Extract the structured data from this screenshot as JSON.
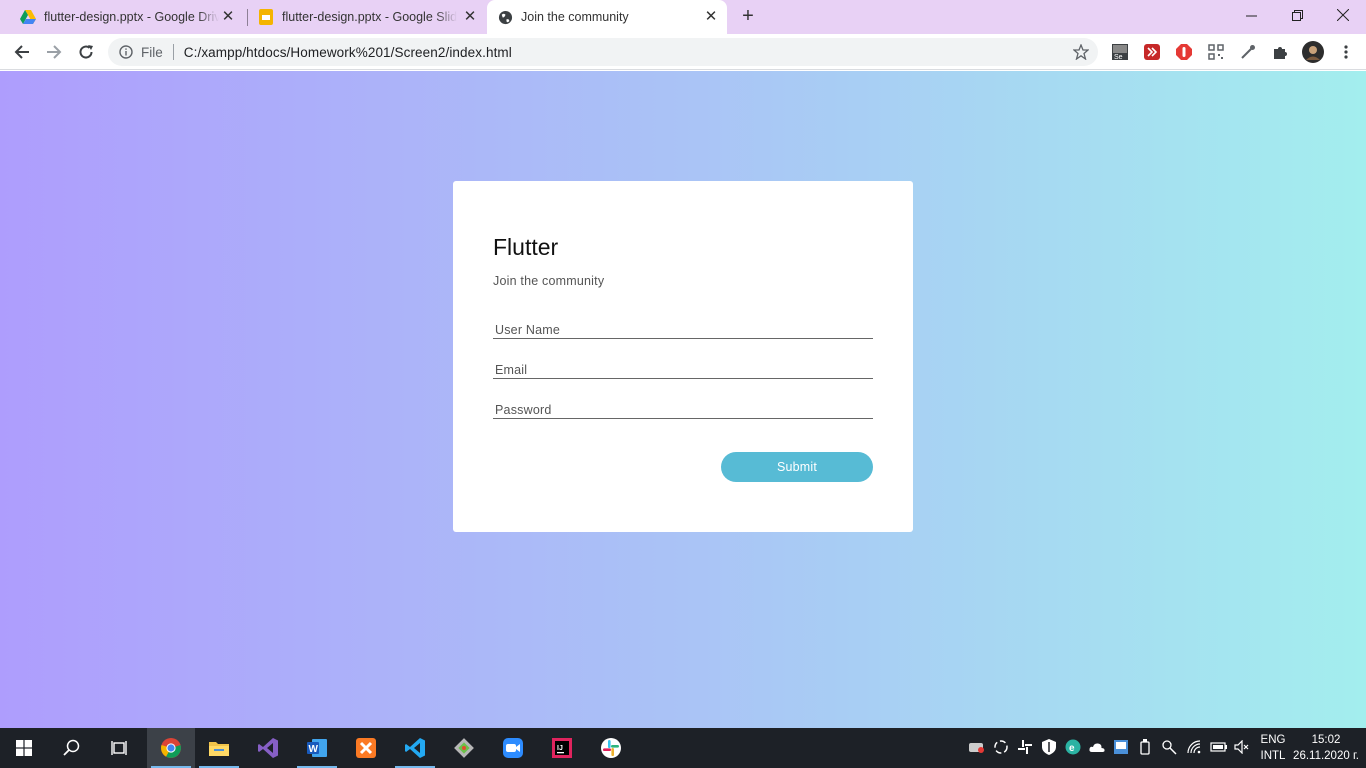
{
  "browser": {
    "tabs": [
      {
        "title": "flutter-design.pptx - Google Drive",
        "icon": "google-drive-icon",
        "active": false
      },
      {
        "title": "flutter-design.pptx - Google Slides",
        "icon": "google-slides-icon",
        "active": false
      },
      {
        "title": "Join the community",
        "icon": "globe-icon",
        "active": true
      }
    ],
    "tab_close_glyph": "✕",
    "new_tab_glyph": "+",
    "window_controls": {
      "minimize": "—",
      "restore": "❐",
      "close": "✕"
    },
    "omnibox": {
      "scheme_label": "File",
      "url": "C:/xampp/htdocs/Homework%201/Screen2/index.html"
    },
    "extensions": [
      "selenium-ide-icon",
      "red-square-extension-icon",
      "adblock-icon",
      "qr-code-icon",
      "eyedropper-icon",
      "puzzle-extensions-icon",
      "profile-avatar"
    ],
    "colors": {
      "tabstrip": "#e8d1f5",
      "toolbar": "#ffffff"
    }
  },
  "page": {
    "card": {
      "title": "Flutter",
      "subtitle": "Join the community",
      "fields": [
        {
          "placeholder": "User Name",
          "type": "text"
        },
        {
          "placeholder": "Email",
          "type": "email"
        },
        {
          "placeholder": "Password",
          "type": "password"
        }
      ],
      "submit_label": "Submit"
    },
    "colors": {
      "gradient_left": "#ae9dfd",
      "gradient_mid": "#aac3f6",
      "gradient_right": "#a3eeee",
      "submit_button": "#57bbd5"
    }
  },
  "taskbar": {
    "apps": [
      "windows-start",
      "search",
      "task-view",
      "chrome",
      "file-explorer",
      "visual-studio",
      "word",
      "xampp",
      "vscode",
      "git",
      "zoom",
      "intellij",
      "slack"
    ],
    "language": {
      "line1": "ENG",
      "line2": "INTL"
    },
    "clock": {
      "time": "15:02",
      "date": "26.11.2020 г."
    }
  }
}
